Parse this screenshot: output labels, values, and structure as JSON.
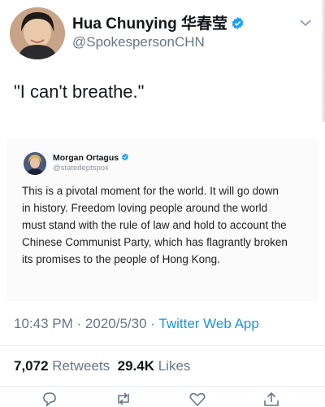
{
  "author": {
    "name": "Hua Chunying 华春莹",
    "handle": "@SpokespersonCHN",
    "verified": true
  },
  "tweet": {
    "text": "\"I can't breathe.\""
  },
  "quoted_screenshot": {
    "name": "Morgan Ortagus",
    "handle": "@statedeptspox",
    "verified": true,
    "lines": [
      "This is a pivotal moment for the world. It will go down",
      "in history. Freedom loving people around the world",
      "must stand with the rule of law and hold to account the",
      "Chinese Communist Party, which has flagrantly broken",
      "its promises to the people of Hong Kong."
    ]
  },
  "meta": {
    "time": "10:43 PM",
    "separator": "·",
    "date": "2020/5/30",
    "app": "Twitter Web App"
  },
  "stats": {
    "retweets_count": "7,072",
    "retweets_label": "Retweets",
    "likes_count": "29.4K",
    "likes_label": "Likes"
  },
  "icons": {
    "verified": "verified-badge-icon",
    "more": "chevron-down-icon",
    "reply": "reply-icon",
    "retweet": "retweet-icon",
    "like": "heart-icon",
    "share": "share-icon"
  },
  "colors": {
    "link": "#1b95e0",
    "verified": "#1da1f2",
    "secondary_text": "#657786"
  }
}
